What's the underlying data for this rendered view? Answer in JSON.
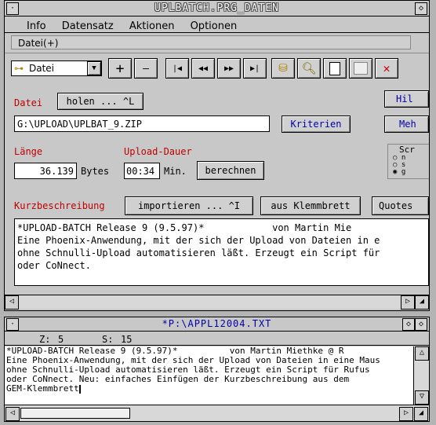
{
  "window1": {
    "title": "UPLBATCH.PRG_DATEN",
    "menu": [
      "Info",
      "Datensatz",
      "Aktionen",
      "Optionen"
    ],
    "submenu": "Datei(+)",
    "toolbar": {
      "dropdown_value": "Datei",
      "dropdown_arrow": "▼",
      "plus": "+",
      "minus": "—",
      "nav": [
        "|◀",
        "◀◀",
        "▶▶",
        "▶|"
      ],
      "close_x": "✕"
    },
    "datei_label": "Datei",
    "holen_button": "holen ... ^L",
    "path_value": "G:\\UPLOAD\\UPLBAT_9.ZIP",
    "kriterien_button": "Kriterien",
    "hilfe_button": "Hil",
    "mehr_button": "Meh",
    "laenge_label": "Länge",
    "laenge_value": "36.139",
    "bytes_label": "Bytes",
    "upload_label": "Upload-Dauer",
    "upload_value": "00:34",
    "min_label": "Min.",
    "berechnen_button": "berechnen",
    "script_group": {
      "title": "Scr",
      "options": [
        "n",
        "s",
        "g"
      ],
      "selected": 2
    },
    "kurz_label": "Kurzbeschreibung",
    "importieren_button": "importieren ... ^I",
    "klemmbrett_button": "aus Klemmbrett",
    "quotes_button": "Quotes",
    "text_lines": [
      "*UPLOAD-BATCH Release 9 (9.5.97)*            von Martin Mie",
      "Eine Phoenix-Anwendung, mit der sich der Upload von Dateien in e",
      "ohne Schnulli-Upload automatisieren läßt. Erzeugt ein Script für",
      "oder CoNnect."
    ]
  },
  "window2": {
    "title": "*P:\\APPL12004.TXT",
    "z_label": "Z:",
    "z_value": "5",
    "s_label": "S:",
    "s_value": "15",
    "text_lines": [
      "*UPLOAD-BATCH Release 9 (9.5.97)*          von Martin Miethke @ R",
      "Eine Phoenix-Anwendung, mit der sich der Upload von Dateien in eine Maus",
      "ohne Schnulli-Upload automatisieren läßt. Erzeugt ein Script für Rufus",
      "oder CoNnect. Neu: einfaches Einfügen der Kurzbeschreibung aus dem",
      "GEM-Klemmbrett"
    ]
  }
}
